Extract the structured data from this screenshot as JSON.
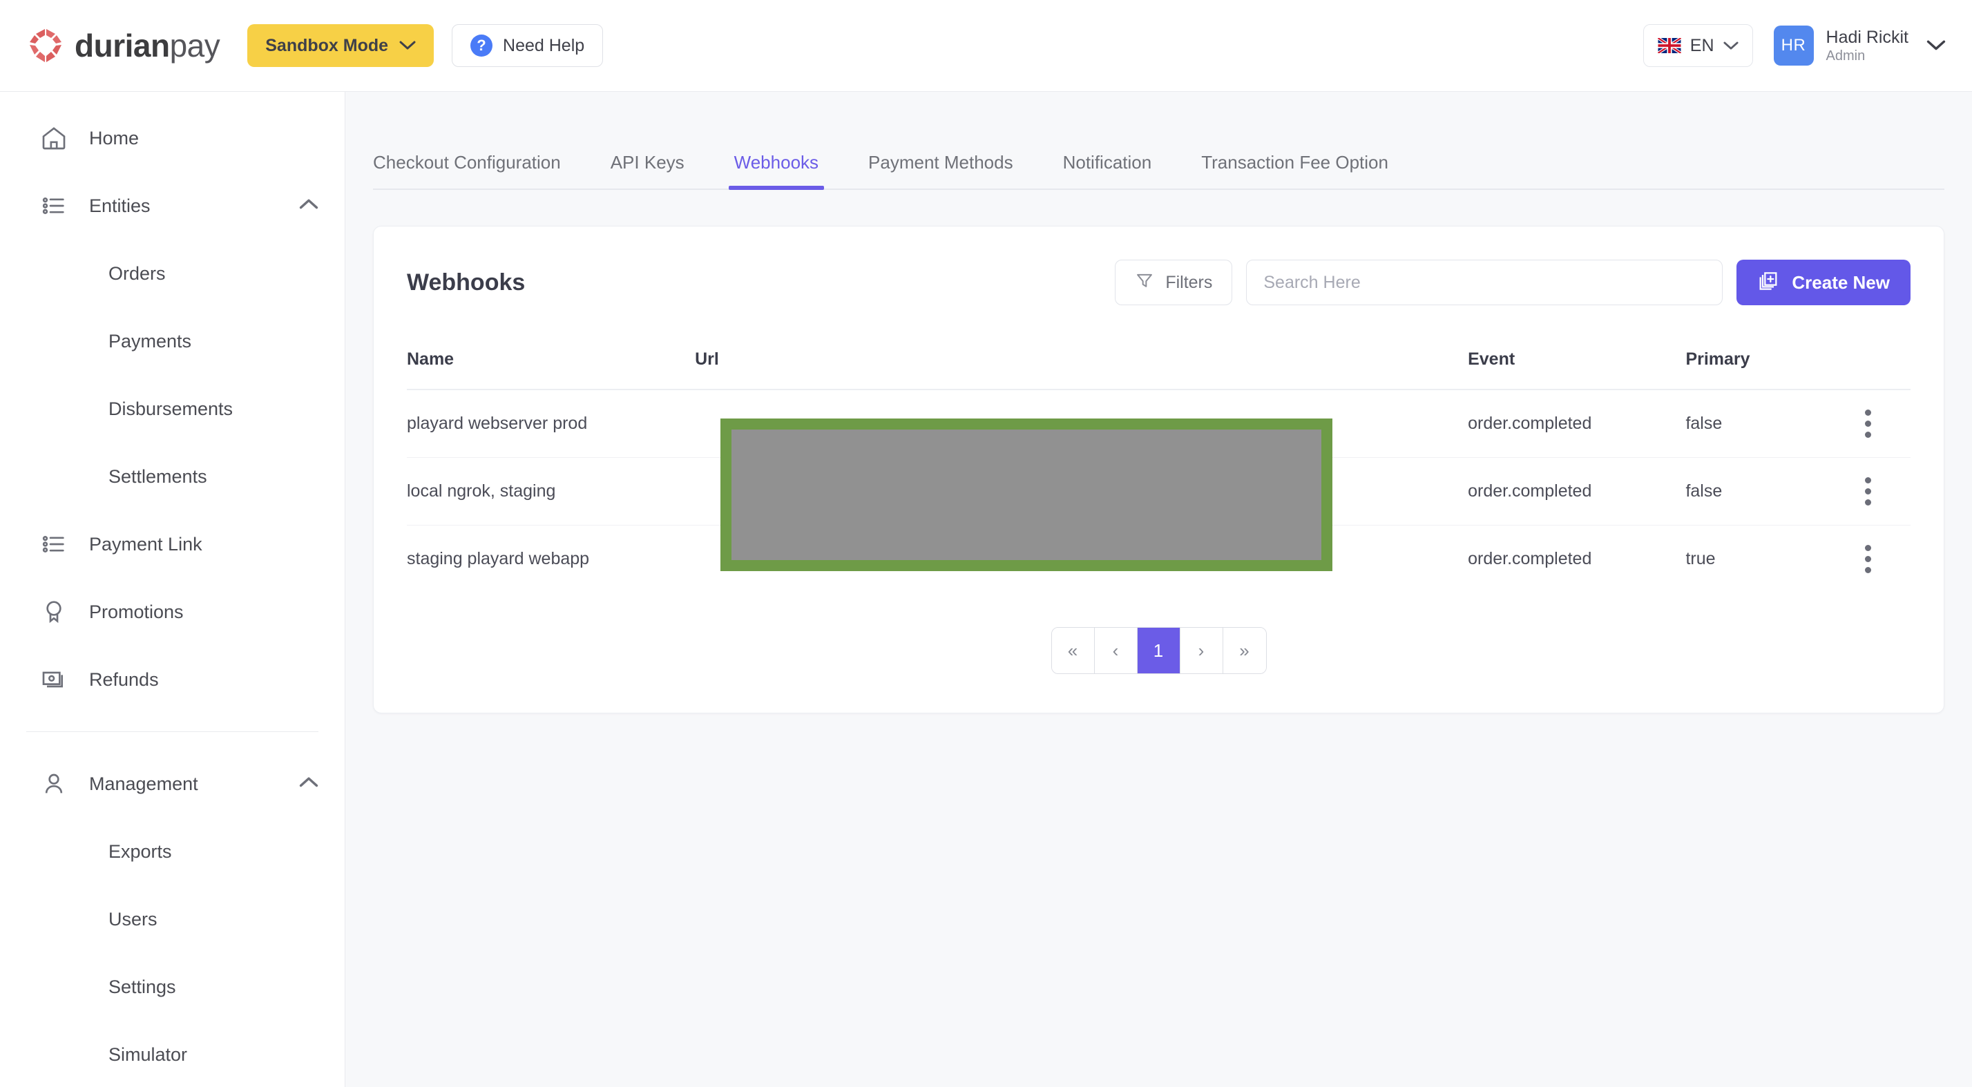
{
  "brand": {
    "name_bold": "durian",
    "name_light": "pay"
  },
  "topbar": {
    "sandbox_label": "Sandbox Mode",
    "need_help_label": "Need Help",
    "help_icon": "question-circle-icon",
    "lang_code": "EN",
    "flag_icon": "uk-flag-icon",
    "avatar_initials": "HR",
    "user_name": "Hadi Rickit",
    "user_role": "Admin",
    "accent_yellow": "#F7D046",
    "avatar_blue": "#5388EE"
  },
  "sidebar": {
    "items": [
      {
        "label": "Home",
        "icon": "home-icon",
        "sub": false,
        "caret": ""
      },
      {
        "label": "Entities",
        "icon": "list-icon",
        "sub": false,
        "caret": "chevron-up-icon"
      },
      {
        "label": "Orders",
        "icon": "",
        "sub": true,
        "caret": ""
      },
      {
        "label": "Payments",
        "icon": "",
        "sub": true,
        "caret": ""
      },
      {
        "label": "Disbursements",
        "icon": "",
        "sub": true,
        "caret": ""
      },
      {
        "label": "Settlements",
        "icon": "",
        "sub": true,
        "caret": ""
      },
      {
        "label": "Payment Link",
        "icon": "list-icon",
        "sub": false,
        "caret": ""
      },
      {
        "label": "Promotions",
        "icon": "badge-icon",
        "sub": false,
        "caret": ""
      },
      {
        "label": "Refunds",
        "icon": "banknote-icon",
        "sub": false,
        "caret": ""
      }
    ],
    "items2": [
      {
        "label": "Management",
        "icon": "user-icon",
        "sub": false,
        "caret": "chevron-up-icon"
      },
      {
        "label": "Exports",
        "icon": "",
        "sub": true,
        "caret": ""
      },
      {
        "label": "Users",
        "icon": "",
        "sub": true,
        "caret": ""
      },
      {
        "label": "Settings",
        "icon": "",
        "sub": true,
        "caret": ""
      },
      {
        "label": "Simulator",
        "icon": "",
        "sub": true,
        "caret": ""
      }
    ]
  },
  "tabs": [
    {
      "label": "Checkout Configuration",
      "active": false
    },
    {
      "label": "API Keys",
      "active": false
    },
    {
      "label": "Webhooks",
      "active": true
    },
    {
      "label": "Payment Methods",
      "active": false
    },
    {
      "label": "Notification",
      "active": false
    },
    {
      "label": "Transaction Fee Option",
      "active": false
    }
  ],
  "card": {
    "title": "Webhooks",
    "filters_label": "Filters",
    "filters_icon": "funnel-icon",
    "search_placeholder": "Search Here",
    "search_value": "",
    "create_label": "Create New",
    "create_icon": "copy-plus-icon",
    "accent_purple": "#6358E8"
  },
  "table": {
    "columns": [
      "Name",
      "Url",
      "Event",
      "Primary"
    ],
    "rows": [
      {
        "name": "playard webserver prod",
        "url": "",
        "event": "order.completed",
        "primary": "false"
      },
      {
        "name": "local ngrok, staging",
        "url": "",
        "event": "order.completed",
        "primary": "false"
      },
      {
        "name": "staging playard webapp",
        "url": "",
        "event": "order.completed",
        "primary": "true"
      }
    ]
  },
  "pagination": {
    "first": "«",
    "prev": "‹",
    "current": "1",
    "next": "›",
    "last": "»"
  },
  "overlay": {
    "border_color": "#6E9B47",
    "fill_color": "#919191"
  }
}
